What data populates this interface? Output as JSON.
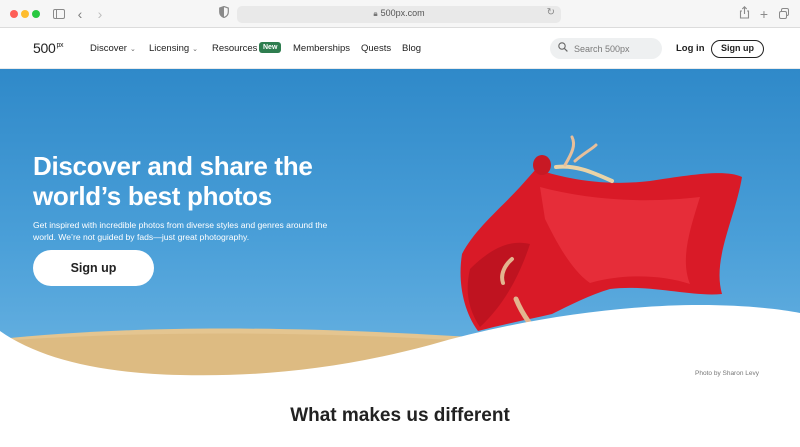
{
  "browser": {
    "url": "500px.com"
  },
  "nav": {
    "logo_text": "500",
    "logo_sup": "px",
    "items": [
      {
        "label": "Discover",
        "has_dropdown": true
      },
      {
        "label": "Licensing",
        "has_dropdown": true
      },
      {
        "label": "Resources",
        "has_dropdown": false
      },
      {
        "label": "Memberships",
        "has_dropdown": false
      },
      {
        "label": "Quests",
        "has_dropdown": false
      },
      {
        "label": "Blog",
        "has_dropdown": false
      }
    ],
    "resources_badge": "New",
    "search_placeholder": "Search 500px",
    "login_label": "Log in",
    "signup_label": "Sign up"
  },
  "hero": {
    "title": "Discover and share the world’s best photos",
    "subtitle": "Get inspired with incredible photos from diverse styles and genres around the world. We’re not guided by fads—just great photography.",
    "cta_label": "Sign up",
    "photo_credit": "Photo by Sharon Levy"
  },
  "section": {
    "title": "What makes us different"
  },
  "colors": {
    "badge_green": "#2e7d4f",
    "sky_blue": "#2f89c9",
    "sand": "#e3c38f",
    "dress_red": "#e0202e"
  }
}
